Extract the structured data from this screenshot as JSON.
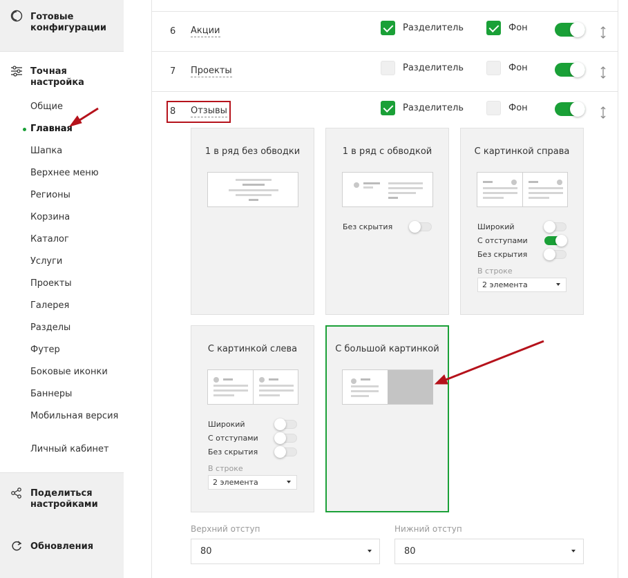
{
  "sidebar": {
    "ready_configs": "Готовые конфигурации",
    "fine_tuning": "Точная настройка",
    "items": [
      {
        "label": "Общие",
        "active": false
      },
      {
        "label": "Главная",
        "active": true
      },
      {
        "label": "Шапка",
        "active": false
      },
      {
        "label": "Верхнее меню",
        "active": false
      },
      {
        "label": "Регионы",
        "active": false
      },
      {
        "label": "Корзина",
        "active": false
      },
      {
        "label": "Каталог",
        "active": false
      },
      {
        "label": "Услуги",
        "active": false
      },
      {
        "label": "Проекты",
        "active": false
      },
      {
        "label": "Галерея",
        "active": false
      },
      {
        "label": "Разделы",
        "active": false
      },
      {
        "label": "Футер",
        "active": false
      },
      {
        "label": "Боковые иконки",
        "active": false
      },
      {
        "label": "Баннеры",
        "active": false
      },
      {
        "label": "Мобильная версия",
        "active": false
      },
      {
        "label": "Личный кабинет",
        "active": false
      }
    ],
    "share": "Поделиться настройками",
    "updates": "Обновления"
  },
  "rows": [
    {
      "num": "6",
      "name": "Акции",
      "divider": true,
      "background": true,
      "enabled": true
    },
    {
      "num": "7",
      "name": "Проекты",
      "divider": false,
      "background": false,
      "enabled": true
    },
    {
      "num": "8",
      "name": "Отзывы",
      "divider": true,
      "background": false,
      "enabled": true
    }
  ],
  "labels": {
    "divider": "Разделитель",
    "background": "Фон"
  },
  "cards": [
    {
      "title": "1 в ряд без обводки"
    },
    {
      "title": "1 в ряд с обводкой",
      "options": [
        {
          "label": "Без скрытия",
          "on": false
        }
      ]
    },
    {
      "title": "С картинкой справа",
      "options": [
        {
          "label": "Широкий",
          "on": false
        },
        {
          "label": "С отступами",
          "on": true
        },
        {
          "label": "Без скрытия",
          "on": false
        }
      ],
      "per_row_label": "В строке",
      "per_row_value": "2 элемента"
    },
    {
      "title": "С картинкой слева",
      "options": [
        {
          "label": "Широкий",
          "on": false
        },
        {
          "label": "С отступами",
          "on": false
        },
        {
          "label": "Без скрытия",
          "on": false
        }
      ],
      "per_row_label": "В строке",
      "per_row_value": "2 элемента"
    },
    {
      "title": "С большой картинкой",
      "selected": true
    }
  ],
  "padding": {
    "top_label": "Верхний отступ",
    "top_value": "80",
    "bottom_label": "Нижний отступ",
    "bottom_value": "80"
  },
  "colors": {
    "accent": "#1aa037",
    "highlight": "#b5121b"
  }
}
